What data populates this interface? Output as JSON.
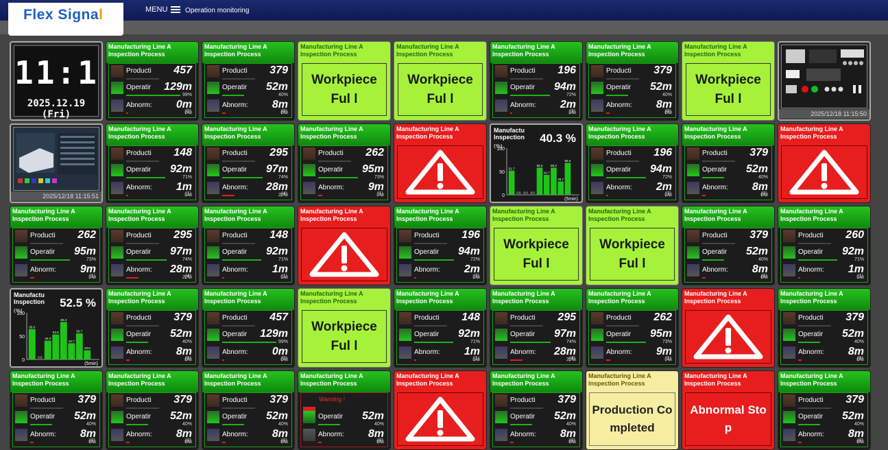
{
  "header": {
    "logo_text": "Flex Signa",
    "logo_text_tail": "l",
    "menu_label": "MENU",
    "screen_title": "Operation monitoring"
  },
  "labels": {
    "line": "Manufacturing Line A",
    "process": "Inspection Process",
    "production": "Producti",
    "operation": "Operatir",
    "abnormal": "Abnorm:",
    "warning": "Warning !",
    "chart_title_1": "Manufactu",
    "chart_title_2": "Inspection",
    "chart_yunit": "(%)",
    "chart_window": "(5min)"
  },
  "colors": {
    "green": "#1fa11a",
    "lime": "#a6f23a",
    "red": "#e81e1e",
    "cream": "#f5eda0"
  },
  "clock": {
    "time": "11:11",
    "date": "2025.12.19 (Fri)"
  },
  "tiles": [
    {
      "type": "clock"
    },
    {
      "type": "metrics",
      "prod": "457",
      "op": "129m",
      "op_pct": "99%",
      "ab": "0m",
      "ab_pct": "0%",
      "count": "(0)",
      "op_frac": 0.99,
      "ab_frac": 0.0
    },
    {
      "type": "metrics",
      "prod": "379",
      "op": "52m",
      "op_pct": "40%",
      "ab": "8m",
      "ab_pct": "6%",
      "count": "(9)",
      "op_frac": 0.4,
      "ab_frac": 0.06
    },
    {
      "type": "status",
      "state": "lime",
      "text": "Workpiece Ful l"
    },
    {
      "type": "status",
      "state": "lime",
      "text": "Workpiece Ful l"
    },
    {
      "type": "metrics",
      "prod": "196",
      "op": "94m",
      "op_pct": "72%",
      "ab": "2m",
      "ab_pct": "2%",
      "count": "(3)",
      "op_frac": 0.72,
      "ab_frac": 0.02
    },
    {
      "type": "metrics",
      "prod": "379",
      "op": "52m",
      "op_pct": "40%",
      "ab": "8m",
      "ab_pct": "6%",
      "count": "(9)",
      "op_frac": 0.4,
      "ab_frac": 0.06
    },
    {
      "type": "status",
      "state": "lime",
      "text": "Workpiece Ful l"
    },
    {
      "type": "camera",
      "variant": "panel",
      "timestamp": "2025/12/18 11:15:50"
    },
    {
      "type": "camera",
      "variant": "machine",
      "timestamp": "2025/12/18 11:15:51"
    },
    {
      "type": "metrics",
      "prod": "148",
      "op": "92m",
      "op_pct": "71%",
      "ab": "1m",
      "ab_pct": "1%",
      "count": "(1)",
      "op_frac": 0.71,
      "ab_frac": 0.01
    },
    {
      "type": "metrics",
      "prod": "295",
      "op": "97m",
      "op_pct": "74%",
      "ab": "28m",
      "ab_pct": "22%",
      "count": "(4)",
      "op_frac": 0.74,
      "ab_frac": 0.22
    },
    {
      "type": "metrics",
      "prod": "262",
      "op": "95m",
      "op_pct": "73%",
      "ab": "9m",
      "ab_pct": "7%",
      "count": "(1)",
      "op_frac": 0.73,
      "ab_frac": 0.07
    },
    {
      "type": "alarm"
    },
    {
      "type": "chart",
      "chart_index": 0
    },
    {
      "type": "metrics",
      "prod": "196",
      "op": "94m",
      "op_pct": "72%",
      "ab": "2m",
      "ab_pct": "2%",
      "count": "(3)",
      "op_frac": 0.72,
      "ab_frac": 0.02
    },
    {
      "type": "metrics",
      "prod": "379",
      "op": "52m",
      "op_pct": "40%",
      "ab": "8m",
      "ab_pct": "6%",
      "count": "(9)",
      "op_frac": 0.4,
      "ab_frac": 0.06
    },
    {
      "type": "alarm"
    },
    {
      "type": "metrics",
      "prod": "262",
      "op": "95m",
      "op_pct": "73%",
      "ab": "9m",
      "ab_pct": "7%",
      "count": "(1)",
      "op_frac": 0.73,
      "ab_frac": 0.07
    },
    {
      "type": "metrics",
      "prod": "295",
      "op": "97m",
      "op_pct": "74%",
      "ab": "28m",
      "ab_pct": "22%",
      "count": "(4)",
      "op_frac": 0.74,
      "ab_frac": 0.22
    },
    {
      "type": "metrics",
      "prod": "148",
      "op": "92m",
      "op_pct": "71%",
      "ab": "1m",
      "ab_pct": "1%",
      "count": "(1)",
      "op_frac": 0.71,
      "ab_frac": 0.01
    },
    {
      "type": "alarm"
    },
    {
      "type": "metrics",
      "prod": "196",
      "op": "94m",
      "op_pct": "72%",
      "ab": "2m",
      "ab_pct": "2%",
      "count": "(3)",
      "op_frac": 0.72,
      "ab_frac": 0.02
    },
    {
      "type": "status",
      "state": "lime",
      "text": "Workpiece Ful l"
    },
    {
      "type": "status",
      "state": "lime",
      "text": "Workpiece Ful l"
    },
    {
      "type": "metrics",
      "prod": "379",
      "op": "52m",
      "op_pct": "40%",
      "ab": "8m",
      "ab_pct": "6%",
      "count": "(9)",
      "op_frac": 0.4,
      "ab_frac": 0.06
    },
    {
      "type": "metrics",
      "prod": "260",
      "op": "92m",
      "op_pct": "71%",
      "ab": "1m",
      "ab_pct": "1%",
      "count": "(1)",
      "op_frac": 0.71,
      "ab_frac": 0.01
    },
    {
      "type": "chart",
      "chart_index": 1
    },
    {
      "type": "metrics",
      "prod": "379",
      "op": "52m",
      "op_pct": "40%",
      "ab": "8m",
      "ab_pct": "6%",
      "count": "(9)",
      "op_frac": 0.4,
      "ab_frac": 0.06
    },
    {
      "type": "metrics",
      "prod": "457",
      "op": "129m",
      "op_pct": "99%",
      "ab": "0m",
      "ab_pct": "0%",
      "count": "(0)",
      "op_frac": 0.99,
      "ab_frac": 0.0
    },
    {
      "type": "status",
      "state": "lime",
      "text": "Workpiece Ful l"
    },
    {
      "type": "metrics",
      "prod": "148",
      "op": "92m",
      "op_pct": "71%",
      "ab": "1m",
      "ab_pct": "1%",
      "count": "(1)",
      "op_frac": 0.71,
      "ab_frac": 0.01
    },
    {
      "type": "metrics",
      "prod": "295",
      "op": "97m",
      "op_pct": "74%",
      "ab": "28m",
      "ab_pct": "22%",
      "count": "(4)",
      "op_frac": 0.74,
      "ab_frac": 0.22
    },
    {
      "type": "metrics",
      "prod": "262",
      "op": "95m",
      "op_pct": "73%",
      "ab": "9m",
      "ab_pct": "7%",
      "count": "(1)",
      "op_frac": 0.73,
      "ab_frac": 0.07
    },
    {
      "type": "alarm"
    },
    {
      "type": "metrics",
      "prod": "379",
      "op": "52m",
      "op_pct": "40%",
      "ab": "8m",
      "ab_pct": "6%",
      "count": "(9)",
      "op_frac": 0.4,
      "ab_frac": 0.06
    },
    {
      "type": "metrics",
      "prod": "379",
      "op": "52m",
      "op_pct": "40%",
      "ab": "8m",
      "ab_pct": "6%",
      "count": "(9)",
      "op_frac": 0.4,
      "ab_frac": 0.06
    },
    {
      "type": "metrics",
      "prod": "379",
      "op": "52m",
      "op_pct": "40%",
      "ab": "8m",
      "ab_pct": "6%",
      "count": "(9)",
      "op_frac": 0.4,
      "ab_frac": 0.06
    },
    {
      "type": "metrics",
      "prod": "379",
      "op": "52m",
      "op_pct": "40%",
      "ab": "8m",
      "ab_pct": "6%",
      "count": "(9)",
      "op_frac": 0.4,
      "ab_frac": 0.06
    },
    {
      "type": "warning",
      "op": "52m",
      "op_pct": "40%",
      "ab": "8m",
      "ab_pct": "6%",
      "count": "(9)",
      "op_frac": 0.4,
      "ab_frac": 0.06
    },
    {
      "type": "alarm"
    },
    {
      "type": "metrics",
      "prod": "379",
      "op": "52m",
      "op_pct": "40%",
      "ab": "8m",
      "ab_pct": "6%",
      "count": "(9)",
      "op_frac": 0.4,
      "ab_frac": 0.06
    },
    {
      "type": "status",
      "state": "cream",
      "text": "Production Co mpleted"
    },
    {
      "type": "status",
      "state": "red",
      "text": "Abnormal Sto p"
    },
    {
      "type": "metrics",
      "prod": "379",
      "op": "52m",
      "op_pct": "40%",
      "ab": "8m",
      "ab_pct": "6%",
      "count": "(9)",
      "op_frac": 0.4,
      "ab_frac": 0.06
    }
  ],
  "chart_data": [
    {
      "type": "bar",
      "title": "40.3 %",
      "ylabel": "(%)",
      "ylim": [
        0,
        100
      ],
      "yticks": [
        "0",
        "50",
        "100"
      ],
      "values": [
        51.7,
        0.0,
        0.0,
        0.0,
        58.3,
        42.7,
        58.3,
        28.7,
        68.6
      ],
      "value_labels": [
        "51.7",
        "0.0",
        "0.0",
        "0.0",
        "58.3",
        "42.7",
        "58.3",
        "28.7",
        "68.6"
      ],
      "bar_color": "#1fc41a",
      "window": "(5min)"
    },
    {
      "type": "bar",
      "title": "52.5 %",
      "ylabel": "(%)",
      "ylim": [
        0,
        100
      ],
      "yticks": [
        "0",
        "50",
        "100"
      ],
      "values": [
        65.0,
        0.0,
        40.3,
        53.6,
        80.3,
        34.7,
        55.7,
        19.6
      ],
      "value_labels": [
        "65.0",
        "0.0",
        "40.3",
        "53.6",
        "80.3",
        "34.7",
        "55.7",
        "19.6"
      ],
      "bar_color": "#1fc41a",
      "window": "(5min)"
    }
  ]
}
